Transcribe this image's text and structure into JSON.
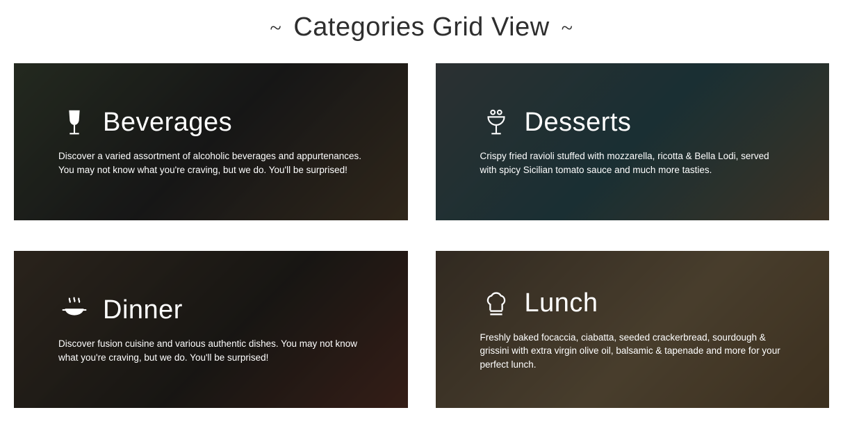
{
  "header": {
    "title": "Categories Grid View"
  },
  "categories": [
    {
      "icon": "wine-glass-icon",
      "title": "Beverages",
      "description": "Discover a varied assortment of alcoholic beverages and appurtenances. You may not know what you're craving, but we do. You'll be surprised!"
    },
    {
      "icon": "dessert-cup-icon",
      "title": "Desserts",
      "description": "Crispy fried ravioli stuffed with mozzarella, ricotta & Bella Lodi, served with spicy Sicilian tomato sauce and much more tasties."
    },
    {
      "icon": "hot-pot-icon",
      "title": "Dinner",
      "description": "Discover fusion cuisine and various authentic dishes. You may not know what you're craving, but we do. You'll be surprised!"
    },
    {
      "icon": "chef-hat-icon",
      "title": "Lunch",
      "description": "Freshly baked focaccia, ciabatta, seeded crackerbread, sourdough & grissini with extra virgin olive oil, balsamic & tapenade and more for your perfect lunch."
    }
  ]
}
